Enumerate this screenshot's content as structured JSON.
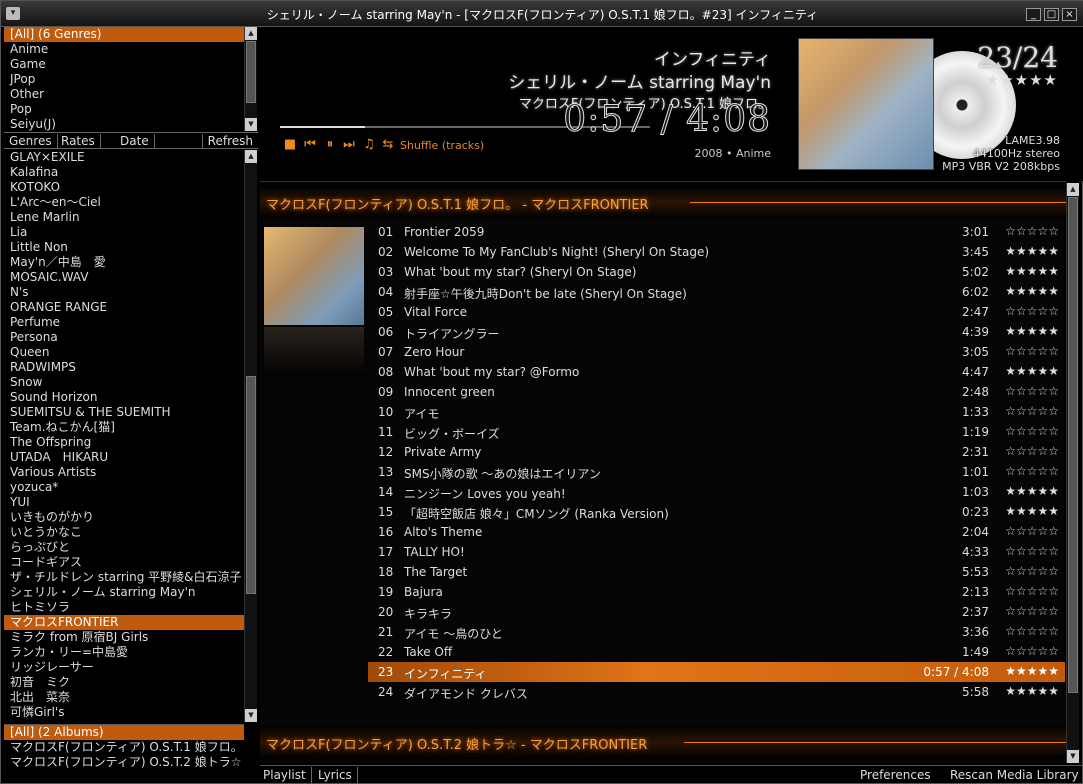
{
  "window": {
    "title": "シェリル・ノーム starring May'n - [マクロスF(フロンティア) O.S.T.1 娘フロ。#23] インフィニティ",
    "min": "_",
    "max": "□",
    "close": "×",
    "menu": "▾"
  },
  "genres": {
    "items": [
      "[All] (6 Genres)",
      "Anime",
      "Game",
      "JPop",
      "Other",
      "Pop",
      "Seiyu(J)"
    ],
    "selected": 0
  },
  "tabs": {
    "genres": "Genres",
    "rates": "Rates",
    "date": "Date",
    "refresh": "Refresh"
  },
  "artists": {
    "items": [
      "GLAY×EXILE",
      "Kalafina",
      "KOTOKO",
      "L'Arc〜en〜Ciel",
      "Lene Marlin",
      "Lia",
      "Little Non",
      "May'n／中島　愛",
      "MOSAIC.WAV",
      "N's",
      "ORANGE RANGE",
      "Perfume",
      "Persona",
      "Queen",
      "RADWIMPS",
      "Snow",
      "Sound Horizon",
      "SUEMITSU & THE SUEMITH",
      "Team.ねこかん[猫]",
      "The Offspring",
      "UTADA　HIKARU",
      "Various Artists",
      "yozuca*",
      "YUI",
      "いきものがかり",
      "いとうかなこ",
      "らっぷびと",
      "コードギアス",
      "ザ・チルドレン starring 平野綾&白石涼子",
      "シェリル・ノーム starring May'n",
      "ヒトミソラ",
      "マクロスFRONTIER",
      "ミラク from 原宿BJ Girls",
      "ランカ・リー=中島愛",
      "リッジレーサー",
      "初音　ミク",
      "北出　菜奈",
      "可憐Girl's"
    ],
    "selected": 31
  },
  "albums": {
    "items": [
      "[All] (2 Albums)",
      "マクロスF(フロンティア) O.S.T.1 娘フロ。",
      "マクロスF(フロンティア) O.S.T.2 娘トラ☆"
    ],
    "selected": 0
  },
  "now_playing": {
    "title": "インフィニティ",
    "artist": "シェリル・ノーム starring May'n",
    "album": "マクロスF(フロンティア) O.S.T.1 娘フロ。",
    "time": "0:57 / 4:08",
    "progress": 0.23,
    "year_genre": "2008 • Anime",
    "track_num": "23/24",
    "rating": "★★★★★",
    "codec": "LAME3.98",
    "format": "44100Hz stereo",
    "bitrate": "MP3 VBR V2 208kbps"
  },
  "controls": {
    "stop": "■",
    "prev": "⏮",
    "pause": "⏸",
    "next": "⏭",
    "music": "♫",
    "repeat": "⇆",
    "shuffle": "Shuffle (tracks)"
  },
  "playlist": {
    "group1": "マクロスF(フロンティア) O.S.T.1 娘フロ。 - マクロスFRONTIER",
    "group2": "マクロスF(フロンティア) O.S.T.2 娘トラ☆ - マクロスFRONTIER",
    "selected": 22,
    "tracks": [
      {
        "n": "01",
        "t": "Frontier 2059",
        "d": "3:01",
        "s": "☆☆☆☆☆"
      },
      {
        "n": "02",
        "t": "Welcome To My FanClub's Night! (Sheryl On Stage)",
        "d": "3:45",
        "s": "★★★★★"
      },
      {
        "n": "03",
        "t": "What 'bout my star? (Sheryl On Stage)",
        "d": "5:02",
        "s": "★★★★★"
      },
      {
        "n": "04",
        "t": "射手座☆午後九時Don't be late (Sheryl On Stage)",
        "d": "6:02",
        "s": "★★★★★"
      },
      {
        "n": "05",
        "t": "Vital Force",
        "d": "2:47",
        "s": "☆☆☆☆☆"
      },
      {
        "n": "06",
        "t": "トライアングラー",
        "d": "4:39",
        "s": "★★★★★"
      },
      {
        "n": "07",
        "t": "Zero Hour",
        "d": "3:05",
        "s": "☆☆☆☆☆"
      },
      {
        "n": "08",
        "t": "What 'bout my star? @Formo",
        "d": "4:47",
        "s": "★★★★★"
      },
      {
        "n": "09",
        "t": "Innocent green",
        "d": "2:48",
        "s": "☆☆☆☆☆"
      },
      {
        "n": "10",
        "t": "アイモ",
        "d": "1:33",
        "s": "☆☆☆☆☆"
      },
      {
        "n": "11",
        "t": "ビッグ・ボーイズ",
        "d": "1:19",
        "s": "☆☆☆☆☆"
      },
      {
        "n": "12",
        "t": "Private Army",
        "d": "2:31",
        "s": "☆☆☆☆☆"
      },
      {
        "n": "13",
        "t": "SMS小隊の歌 〜あの娘はエイリアン",
        "d": "1:01",
        "s": "☆☆☆☆☆"
      },
      {
        "n": "14",
        "t": "ニンジーン Loves you yeah!",
        "d": "1:03",
        "s": "★★★★★"
      },
      {
        "n": "15",
        "t": "「超時空飯店 娘々」CMソング (Ranka Version)",
        "d": "0:23",
        "s": "★★★★★"
      },
      {
        "n": "16",
        "t": "Alto's Theme",
        "d": "2:04",
        "s": "☆☆☆☆☆"
      },
      {
        "n": "17",
        "t": "TALLY HO!",
        "d": "4:33",
        "s": "☆☆☆☆☆"
      },
      {
        "n": "18",
        "t": "The Target",
        "d": "5:53",
        "s": "☆☆☆☆☆"
      },
      {
        "n": "19",
        "t": "Bajura",
        "d": "2:13",
        "s": "☆☆☆☆☆"
      },
      {
        "n": "20",
        "t": "キラキラ",
        "d": "2:37",
        "s": "☆☆☆☆☆"
      },
      {
        "n": "21",
        "t": "アイモ 〜鳥のひと",
        "d": "3:36",
        "s": "☆☆☆☆☆"
      },
      {
        "n": "22",
        "t": "Take Off",
        "d": "1:49",
        "s": "☆☆☆☆☆"
      },
      {
        "n": "23",
        "t": "インフィニティ",
        "d": "0:57 / 4:08",
        "s": "★★★★★"
      },
      {
        "n": "24",
        "t": "ダイアモンド クレバス",
        "d": "5:58",
        "s": "★★★★★"
      }
    ]
  },
  "status": {
    "playlist": "Playlist",
    "lyrics": "Lyrics",
    "preferences": "Preferences",
    "rescan": "Rescan Media Library"
  }
}
